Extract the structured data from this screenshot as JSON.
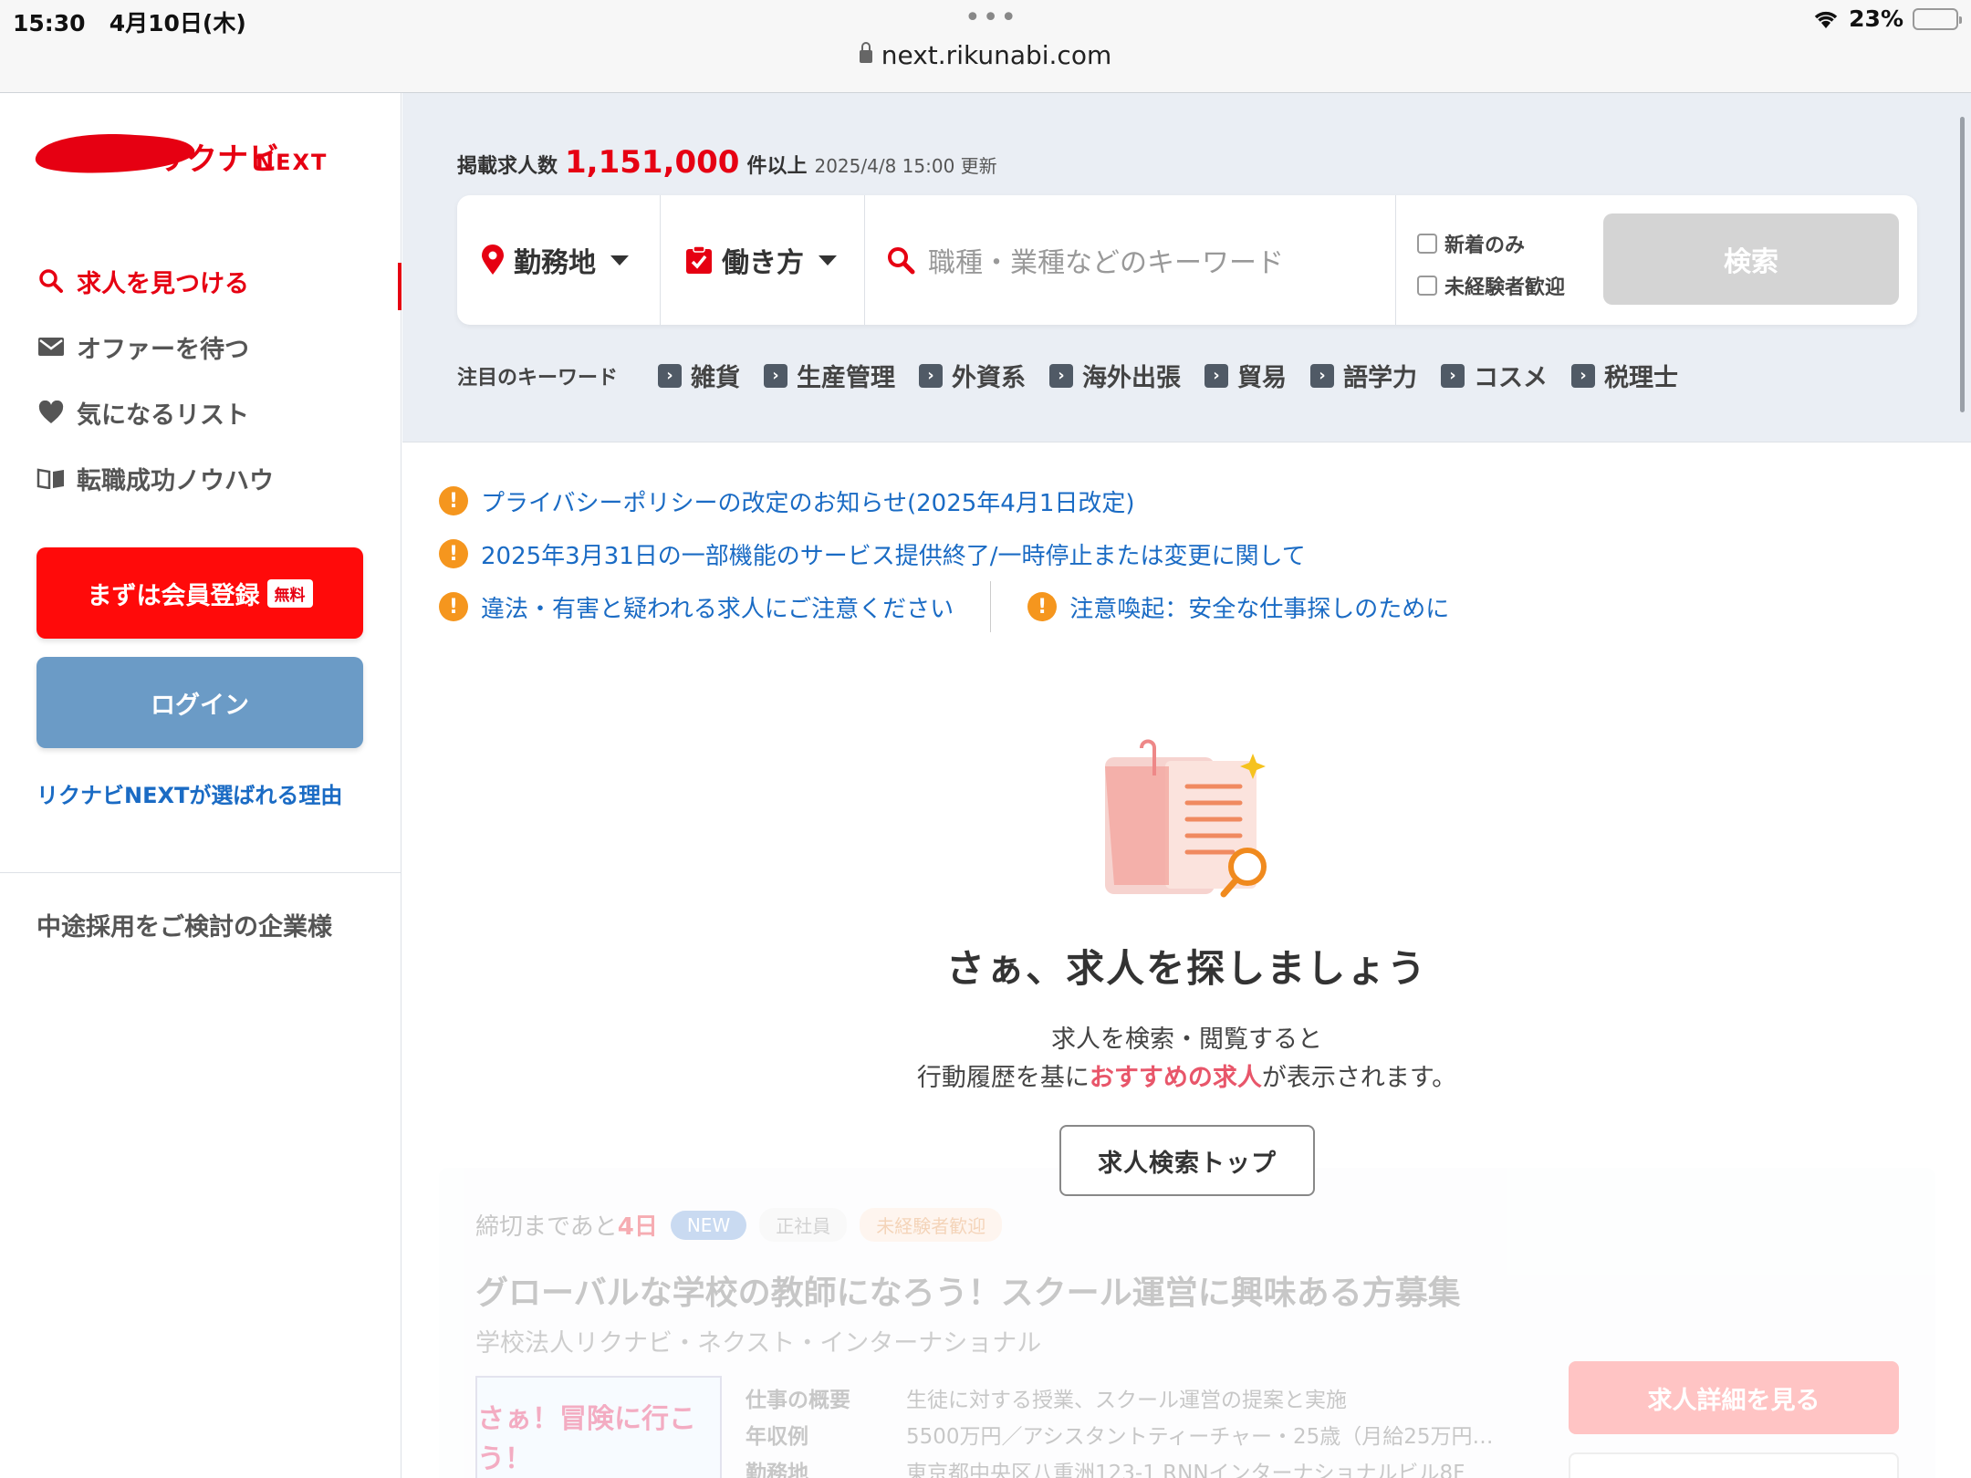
{
  "status": {
    "time": "15:30",
    "date": "4月10日(木)",
    "url": "next.rikunabi.com",
    "battery": "23%",
    "battery_level": 0.23
  },
  "brand": {
    "logo_text": "リクナビ",
    "logo_suffix": "NEXT",
    "accent": "#e60012"
  },
  "sidebar": {
    "nav": [
      {
        "label": "求人を見つける",
        "icon": "search-icon",
        "active": true
      },
      {
        "label": "オファーを待つ",
        "icon": "mail-icon",
        "active": false
      },
      {
        "label": "気になるリスト",
        "icon": "heart-icon",
        "active": false
      },
      {
        "label": "転職成功ノウハウ",
        "icon": "book-icon",
        "active": false
      }
    ],
    "register_label": "まずは会員登録",
    "register_badge": "無料",
    "login_label": "ログイン",
    "why_link": "リクナビNEXTが選ばれる理由",
    "corporate_link": "中途採用をご検討の企業様"
  },
  "search": {
    "count_prefix": "掲載求人数",
    "count": "1,151,000",
    "count_suffix": "件以上",
    "updated": "2025/4/8 15:00 更新",
    "location_label": "勤務地",
    "workstyle_label": "働き方",
    "keyword_placeholder": "職種・業種などのキーワード",
    "check_new": "新着のみ",
    "check_inexperienced": "未経験者歓迎",
    "search_button": "検索",
    "hot_keywords_label": "注目のキーワード",
    "hot_keywords": [
      "雑貨",
      "生産管理",
      "外資系",
      "海外出張",
      "貿易",
      "語学力",
      "コスメ",
      "税理士"
    ]
  },
  "notices": {
    "items": [
      "プライバシーポリシーの改定のお知らせ(2025年4月1日改定)",
      "2025年3月31日の一部機能のサービス提供終了/一時停止または変更に関して",
      "違法・有害と疑われる求人にご注意ください",
      "注意喚起：安全な仕事探しのために"
    ]
  },
  "empty": {
    "title": "さぁ、求人を探しましょう",
    "line1": "求人を検索・閲覧すると",
    "line2_pre": "行動履歴を基に",
    "line2_em": "おすすめの求人",
    "line2_post": "が表示されます。",
    "top_button": "求人検索トップ"
  },
  "job_card": {
    "deadline_pre": "締切まであと",
    "deadline_days": "4日",
    "tags": [
      "NEW",
      "正社員",
      "未経験者歓迎"
    ],
    "title": "グローバルな学校の教師になろう！スクール運営に興味ある方募集",
    "company": "学校法人リクナビ・ネクスト・インターナショナル",
    "image_text": "さぁ！冒険に行こう！",
    "rows": [
      {
        "label": "仕事の概要",
        "value": "生徒に対する授業、スクール運営の提案と実施"
      },
      {
        "label": "年収例",
        "value": "5500万円／アシスタントティーチャー・25歳（月給25万円…"
      },
      {
        "label": "勤務地",
        "value": "東京都中央区八重洲123-1 RNNインターナショナルビル8F"
      }
    ],
    "detail_button": "求人詳細を見る"
  }
}
